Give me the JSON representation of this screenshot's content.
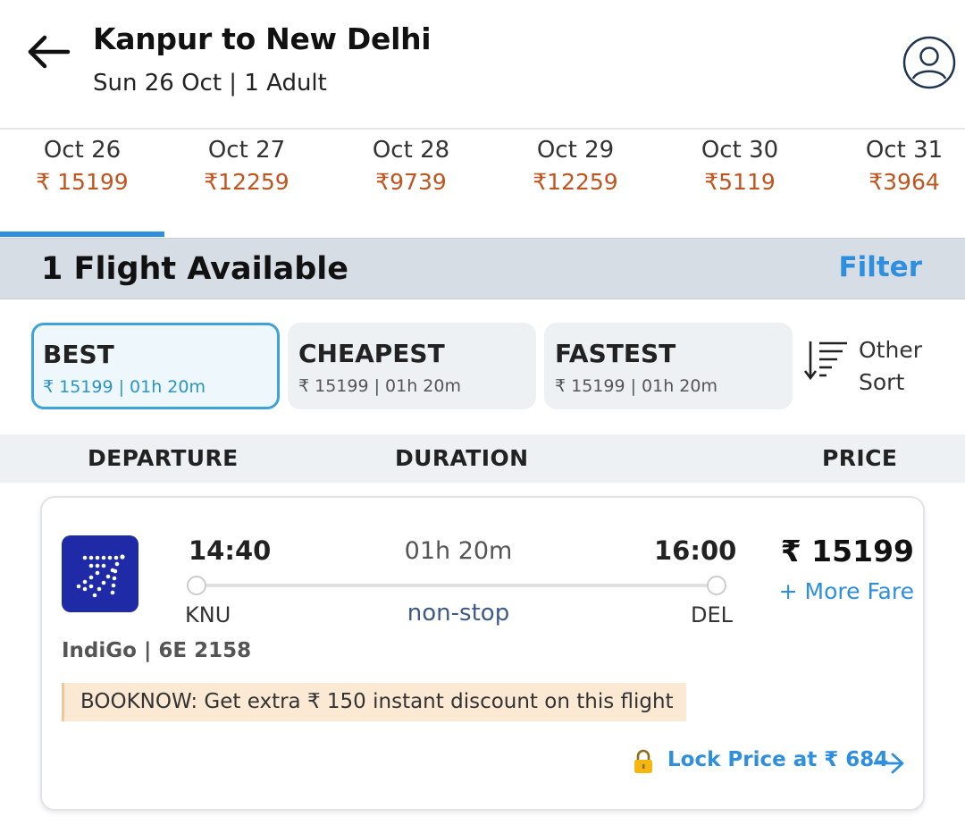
{
  "header": {
    "title": "Kanpur to New Delhi",
    "subtitle": "Sun 26 Oct | 1 Adult",
    "back_icon": "arrow-left-icon",
    "profile_icon": "user-circle-icon"
  },
  "date_strip": {
    "selected_index": 0,
    "items": [
      {
        "date": "Oct 26",
        "price": "₹ 15199"
      },
      {
        "date": "Oct 27",
        "price": "₹12259"
      },
      {
        "date": "Oct 28",
        "price": "₹9739"
      },
      {
        "date": "Oct 29",
        "price": "₹12259"
      },
      {
        "date": "Oct 30",
        "price": "₹5119"
      },
      {
        "date": "Oct 31",
        "price": "₹3964"
      }
    ]
  },
  "results": {
    "count_label": "1 Flight Available",
    "filter_label": "Filter"
  },
  "sort": {
    "options": [
      {
        "label": "BEST",
        "sub": "₹ 15199 | 01h 20m",
        "active": true
      },
      {
        "label": "CHEAPEST",
        "sub": "₹ 15199 | 01h 20m",
        "active": false
      },
      {
        "label": "FASTEST",
        "sub": "₹ 15199 | 01h 20m",
        "active": false
      }
    ],
    "other_line1": "Other",
    "other_line2": "Sort"
  },
  "columns": {
    "departure": "DEPARTURE",
    "duration": "DURATION",
    "price": "PRICE"
  },
  "flight": {
    "dep_time": "14:40",
    "arr_time": "16:00",
    "duration": "01h 20m",
    "dep_code": "KNU",
    "arr_code": "DEL",
    "stops": "non-stop",
    "price": "₹ 15199",
    "more_fare": "+ More Fare",
    "airline": "IndiGo | 6E 2158",
    "promo": "BOOKNOW: Get extra ₹ 150 instant discount on this flight",
    "lock_price": "Lock Price at ₹ 684"
  },
  "colors": {
    "accent_blue": "#2e8ee0",
    "price_orange": "#c0551f",
    "indigo_logo": "#1e2aa6",
    "promo_bg": "#fce9d4"
  }
}
